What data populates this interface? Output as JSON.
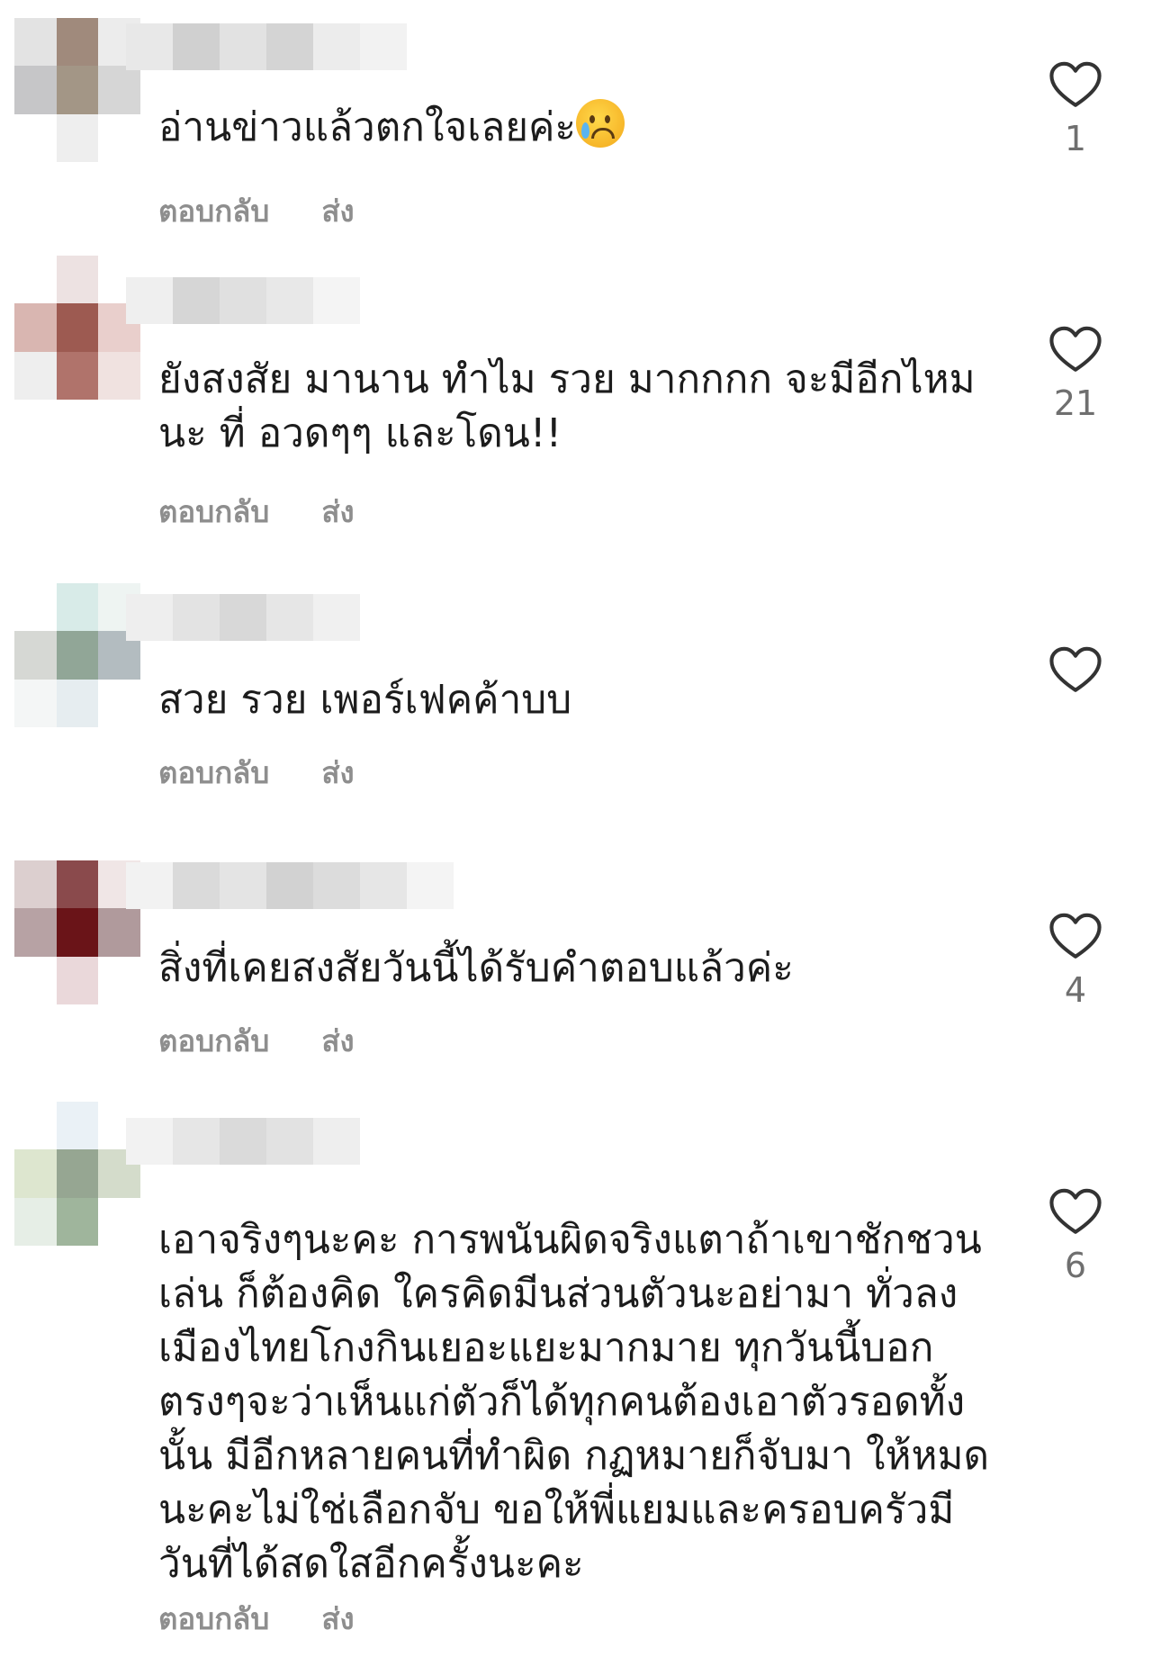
{
  "actions": {
    "reply": "ตอบกลับ",
    "send": "ส่ง"
  },
  "icons": {
    "like": "heart-outline-icon",
    "emoji": "crying-face-icon"
  },
  "colors": {
    "text": "#1c1c1c",
    "muted": "#8e8e8e",
    "count": "#6f6f6f"
  },
  "comments": [
    {
      "text": "อ่านข่าวแล้วตกใจเลยค่ะ",
      "emoji": "😢",
      "like_count": "1",
      "avatar_colors": [
        "#e3e3e3",
        "#a08a7c",
        "#ececec",
        "#c6c6c8",
        "#a39686",
        "#d6d6d6",
        "#ffffff",
        "#eeeeee",
        "#ffffff"
      ],
      "username_colors": [
        "#e8e8e8",
        "#d0d0d0",
        "#e2e2e2",
        "#d4d4d4",
        "#ececec",
        "#f2f2f2"
      ]
    },
    {
      "text": "ยังสงสัย มานาน ทำไม รวย มากกกก จะมีอีกไหมนะ ที่ อวดๆๆ และโดน!!",
      "like_count": "21",
      "avatar_colors": [
        "#ffffff",
        "#ede2e2",
        "#ffffff",
        "#d9b6b1",
        "#9d5a51",
        "#e9cfcc",
        "#eeeeee",
        "#b0736b",
        "#f0e2e0"
      ],
      "username_colors": [
        "#efefef",
        "#d6d6d6",
        "#e0e0e0",
        "#e8e8e8",
        "#f4f4f4"
      ]
    },
    {
      "text": "สวย รวย เพอร์เฟคค้าบบ",
      "like_count": "",
      "avatar_colors": [
        "#ffffff",
        "#d8ebe8",
        "#eef4f2",
        "#d6d8d4",
        "#91a697",
        "#b3bcc0",
        "#f4f6f6",
        "#e6edf0",
        "#ffffff"
      ],
      "username_colors": [
        "#eeeeee",
        "#e3e3e3",
        "#d8d8d8",
        "#e6e6e6",
        "#f0f0f0"
      ]
    },
    {
      "text": "สิ่งที่เคยสงสัยวันนี้ได้รับคำตอบแล้วค่ะ",
      "like_count": "4",
      "avatar_colors": [
        "#dccfcf",
        "#8a4a4c",
        "#f0e6e6",
        "#b7a2a4",
        "#6a1418",
        "#b09a9c",
        "#ffffff",
        "#ead8da",
        "#ffffff"
      ],
      "username_colors": [
        "#f2f2f2",
        "#dadada",
        "#e4e4e4",
        "#d2d2d2",
        "#dcdcdc",
        "#e6e6e6",
        "#f4f4f4"
      ]
    },
    {
      "text": "เอาจริงๆนะคะ การพนันผิดจริงแตาถ้าเขาชักชวนเล่น ก็ต้องคิด ใครคิดมีนส่วนตัวนะอย่ามา ทั่วลงเมืองไทยโกงกินเยอะแยะมากมาย ทุกวันนี้บอกตรงๆจะว่าเห็นแก่ตัวก็ได้ทุกคนต้องเอาตัวรอดทั้งนั้น มีอีกหลายคนที่ทำผิด กฏหมายก็จับมา ให้หมดนะคะไม่ใช่เลือกจับ ขอให้พี่แยมและครอบครัวมีวันที่ได้สดใสอีกครั้งนะคะ",
      "like_count": "6",
      "avatar_colors": [
        "#ffffff",
        "#eaf1f6",
        "#ffffff",
        "#dde6cf",
        "#96a692",
        "#d4dccb",
        "#e6eee6",
        "#9fb59c",
        "#ffffff"
      ],
      "username_colors": [
        "#f2f2f2",
        "#e6e6e6",
        "#dadada",
        "#e2e2e2",
        "#eeeeee"
      ]
    }
  ]
}
